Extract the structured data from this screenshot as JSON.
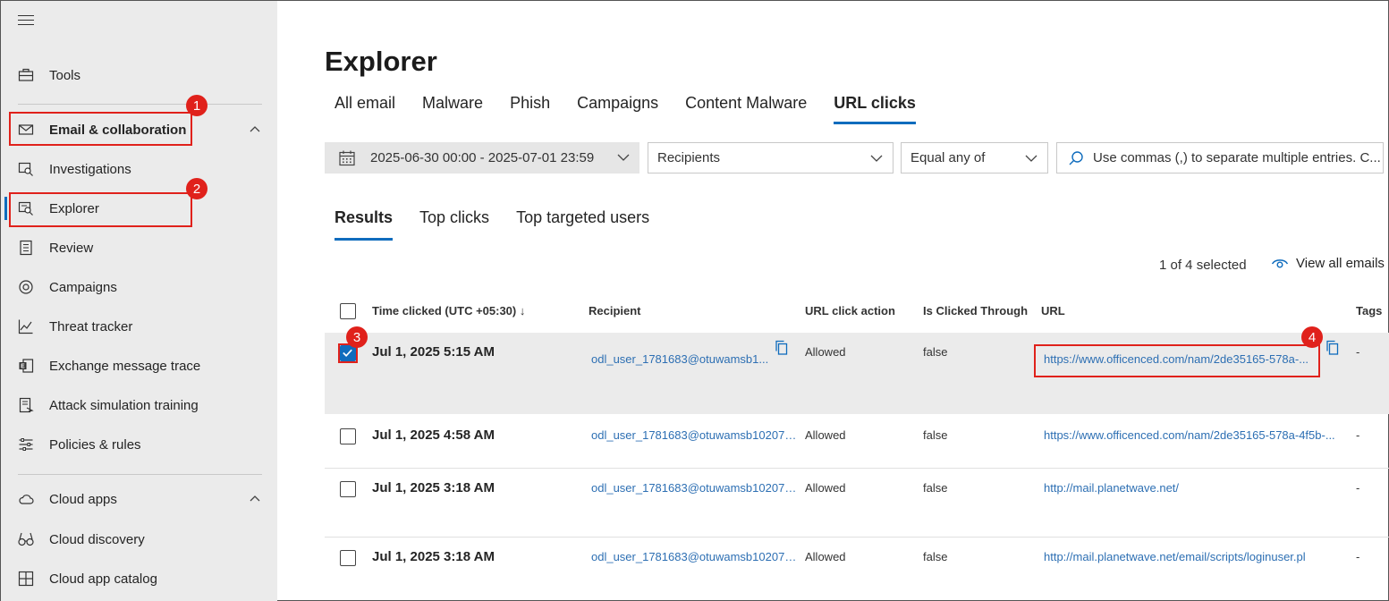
{
  "sidebar": {
    "items": [
      {
        "label": "Tools",
        "icon": "toolbox-icon"
      },
      {
        "label": "Email & collaboration",
        "icon": "mail-icon"
      },
      {
        "label": "Investigations",
        "icon": "investigation-icon"
      },
      {
        "label": "Explorer",
        "icon": "explorer-icon"
      },
      {
        "label": "Review",
        "icon": "review-icon"
      },
      {
        "label": "Campaigns",
        "icon": "campaigns-icon"
      },
      {
        "label": "Threat tracker",
        "icon": "threat-tracker-icon"
      },
      {
        "label": "Exchange message trace",
        "icon": "exchange-icon"
      },
      {
        "label": "Attack simulation training",
        "icon": "attack-sim-icon"
      },
      {
        "label": "Policies & rules",
        "icon": "policies-icon"
      },
      {
        "label": "Cloud apps",
        "icon": "cloud-icon"
      },
      {
        "label": "Cloud discovery",
        "icon": "binoculars-icon"
      },
      {
        "label": "Cloud app catalog",
        "icon": "catalog-icon"
      }
    ]
  },
  "badges": [
    "1",
    "2",
    "3",
    "4"
  ],
  "main": {
    "title": "Explorer",
    "tabs": [
      "All email",
      "Malware",
      "Phish",
      "Campaigns",
      "Content Malware",
      "URL clicks"
    ],
    "active_tab": "URL clicks",
    "filters": {
      "date_range": "2025-06-30 00:00 - 2025-07-01 23:59",
      "field": "Recipients",
      "operator": "Equal any of",
      "search_placeholder": "Use commas (,) to separate multiple entries. C..."
    },
    "subtabs": [
      "Results",
      "Top clicks",
      "Top targeted users"
    ],
    "active_subtab": "Results",
    "selection_text": "1 of 4 selected",
    "view_all_label": "View all emails",
    "table": {
      "headers": [
        "Time clicked (UTC +05:30) ↓",
        "Recipient",
        "URL click action",
        "Is Clicked Through",
        "URL",
        "Tags"
      ],
      "rows": [
        {
          "time": "Jul 1, 2025 5:15 AM",
          "recipient": "odl_user_1781683@otuwamsb1...",
          "action": "Allowed",
          "clicked_through": "false",
          "url": "https://www.officenced.com/nam/2de35165-578a-...",
          "tags": "-",
          "selected": true
        },
        {
          "time": "Jul 1, 2025 4:58 AM",
          "recipient": "odl_user_1781683@otuwamsb102074...",
          "action": "Allowed",
          "clicked_through": "false",
          "url": "https://www.officenced.com/nam/2de35165-578a-4f5b-...",
          "tags": "-",
          "selected": false
        },
        {
          "time": "Jul 1, 2025 3:18 AM",
          "recipient": "odl_user_1781683@otuwamsb102074...",
          "action": "Allowed",
          "clicked_through": "false",
          "url": "http://mail.planetwave.net/",
          "tags": "-",
          "selected": false
        },
        {
          "time": "Jul 1, 2025 3:18 AM",
          "recipient": "odl_user_1781683@otuwamsb102074...",
          "action": "Allowed",
          "clicked_through": "false",
          "url": "http://mail.planetwave.net/email/scripts/loginuser.pl",
          "tags": "-",
          "selected": false
        }
      ]
    }
  },
  "colors": {
    "accent": "#0f6cbd",
    "annotation": "#e0211b",
    "link": "#2d6fb3"
  }
}
